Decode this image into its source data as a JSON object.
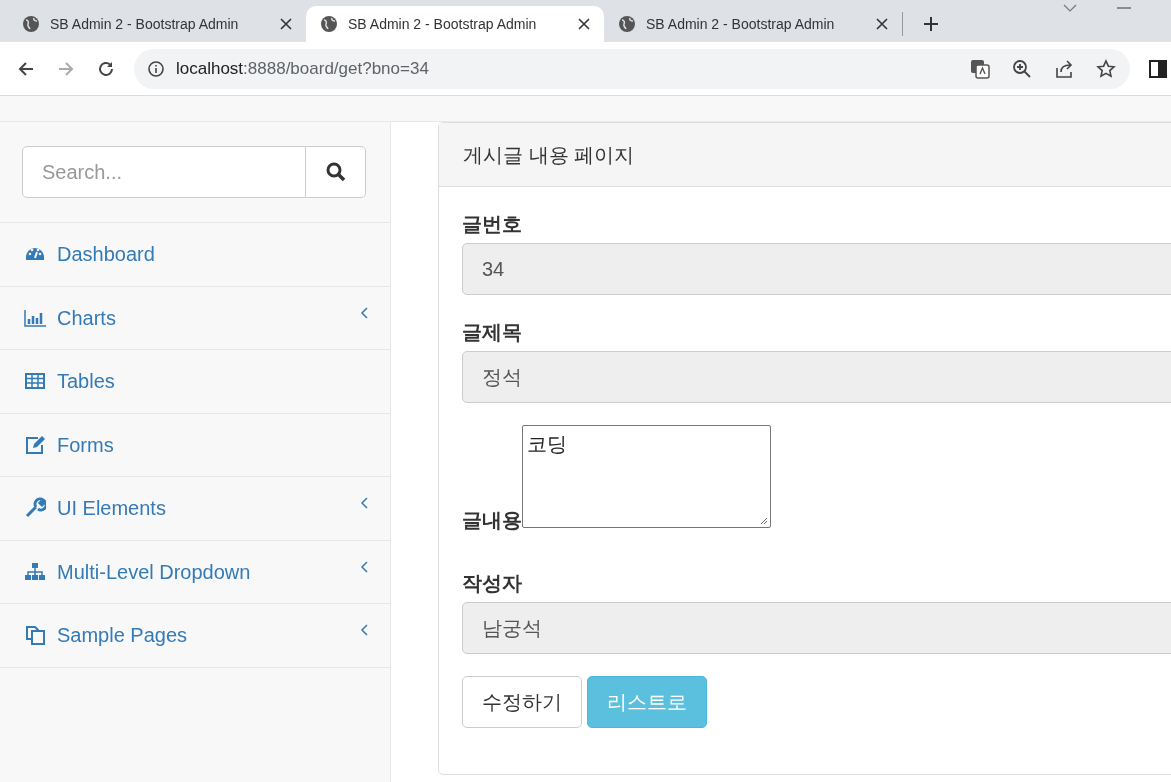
{
  "browser": {
    "tabs": [
      {
        "title": "SB Admin 2 - Bootstrap Admin",
        "selected": false
      },
      {
        "title": "SB Admin 2 - Bootstrap Admin",
        "selected": true
      },
      {
        "title": "SB Admin 2 - Bootstrap Admin",
        "selected": false
      }
    ],
    "address": {
      "host": "localhost",
      "rest": ":8888/board/get?bno=34"
    }
  },
  "sidebar": {
    "search": {
      "placeholder": "Search..."
    },
    "items": [
      {
        "label": "Dashboard",
        "has_submenu": false
      },
      {
        "label": "Charts",
        "has_submenu": true
      },
      {
        "label": "Tables",
        "has_submenu": false
      },
      {
        "label": "Forms",
        "has_submenu": false
      },
      {
        "label": "UI Elements",
        "has_submenu": true
      },
      {
        "label": "Multi-Level Dropdown",
        "has_submenu": true
      },
      {
        "label": "Sample Pages",
        "has_submenu": true
      }
    ]
  },
  "card": {
    "title": "게시글 내용 페이지",
    "fields": [
      {
        "kind": "input",
        "label": "글번호",
        "value": "34"
      },
      {
        "kind": "input",
        "label": "글제목",
        "value": "정석"
      },
      {
        "kind": "textarea",
        "label": "글내용",
        "value": "코딩"
      },
      {
        "kind": "input",
        "label": "작성자",
        "value": "남궁석"
      }
    ],
    "buttons": [
      {
        "kind": "default",
        "label": "수정하기"
      },
      {
        "kind": "info",
        "label": "리스트로"
      }
    ]
  }
}
